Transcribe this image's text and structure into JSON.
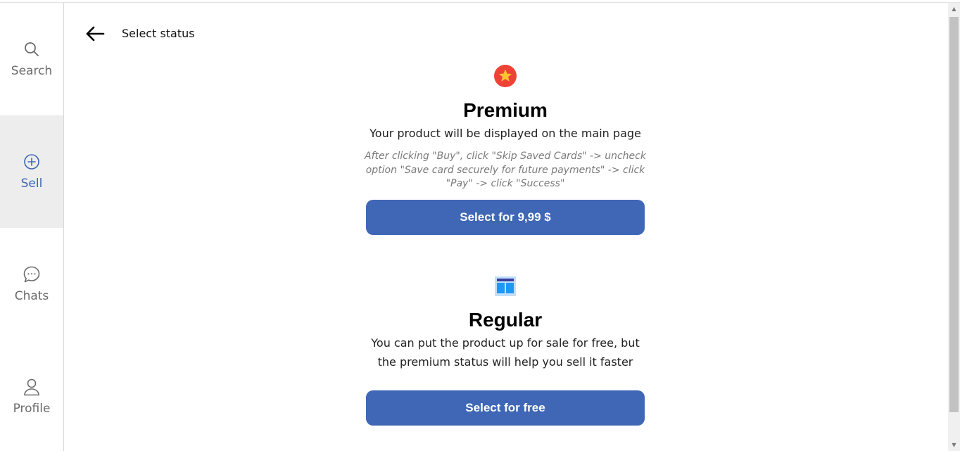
{
  "sidebar": {
    "items": [
      {
        "label": "Search",
        "icon": "search-icon",
        "active": false
      },
      {
        "label": "Sell",
        "icon": "plus-circle-icon",
        "active": true
      },
      {
        "label": "Chats",
        "icon": "chat-bubble-icon",
        "active": false
      },
      {
        "label": "Profile",
        "icon": "user-icon",
        "active": false
      }
    ]
  },
  "header": {
    "title": "Select status",
    "back_icon": "arrow-left-icon"
  },
  "premium": {
    "icon": "star-badge-icon",
    "title": "Premium",
    "description": "Your product will be displayed on the main page",
    "note": "After clicking \"Buy\", click \"Skip Saved Cards\" -> uncheck option \"Save card securely for future payments\" -> click \"Pay\" -> click \"Success\"",
    "button_label": "Select for 9,99 $"
  },
  "regular": {
    "icon": "layout-board-icon",
    "title": "Regular",
    "description": "You can put the product up for sale for free, but the premium status will help you sell it faster",
    "button_label": "Select for free"
  },
  "colors": {
    "accent": "#3f67b6",
    "active_nav_bg": "#ededed",
    "star_badge": "#ef4237",
    "star": "#fbc531"
  }
}
